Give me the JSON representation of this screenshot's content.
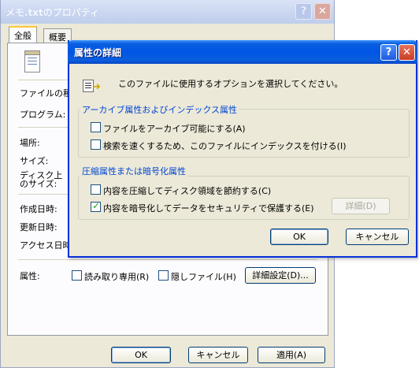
{
  "props": {
    "title": "メモ.txtのプロパティ",
    "tabs": [
      "全般",
      "概要"
    ],
    "fields": {
      "file_type": "ファイルの種類",
      "program": "プログラム:",
      "location": "場所:",
      "size": "サイズ:",
      "size_on_disk": "ディスク上\nのサイズ:",
      "created": "作成日時:",
      "modified": "更新日時:",
      "accessed": "アクセス日時:"
    },
    "attributes": {
      "label": "属性:",
      "readonly_label": "読み取り専用(R)",
      "readonly_checked": false,
      "hidden_label": "隠しファイル(H)",
      "hidden_checked": false,
      "advanced_button": "詳細設定(D)..."
    },
    "buttons": {
      "ok": "OK",
      "cancel": "キャンセル",
      "apply": "適用(A)"
    }
  },
  "advanced": {
    "title": "属性の詳細",
    "description": "このファイルに使用するオプションを選択してください。",
    "archive_group": {
      "title": "アーカイブ属性およびインデックス属性",
      "archive_label": "ファイルをアーカイブ可能にする(A)",
      "archive_checked": false,
      "index_label": "検索を速くするため、このファイルにインデックスを付ける(I)",
      "index_checked": false
    },
    "compress_group": {
      "title": "圧縮属性または暗号化属性",
      "compress_label": "内容を圧縮してディスク領域を節約する(C)",
      "compress_checked": false,
      "encrypt_label": "内容を暗号化してデータをセキュリティで保護する(E)",
      "encrypt_checked": true,
      "details_button": "詳細(D)"
    },
    "buttons": {
      "ok": "OK",
      "cancel": "キャンセル"
    }
  },
  "icons": {
    "help": "help-icon",
    "close": "close-icon"
  }
}
